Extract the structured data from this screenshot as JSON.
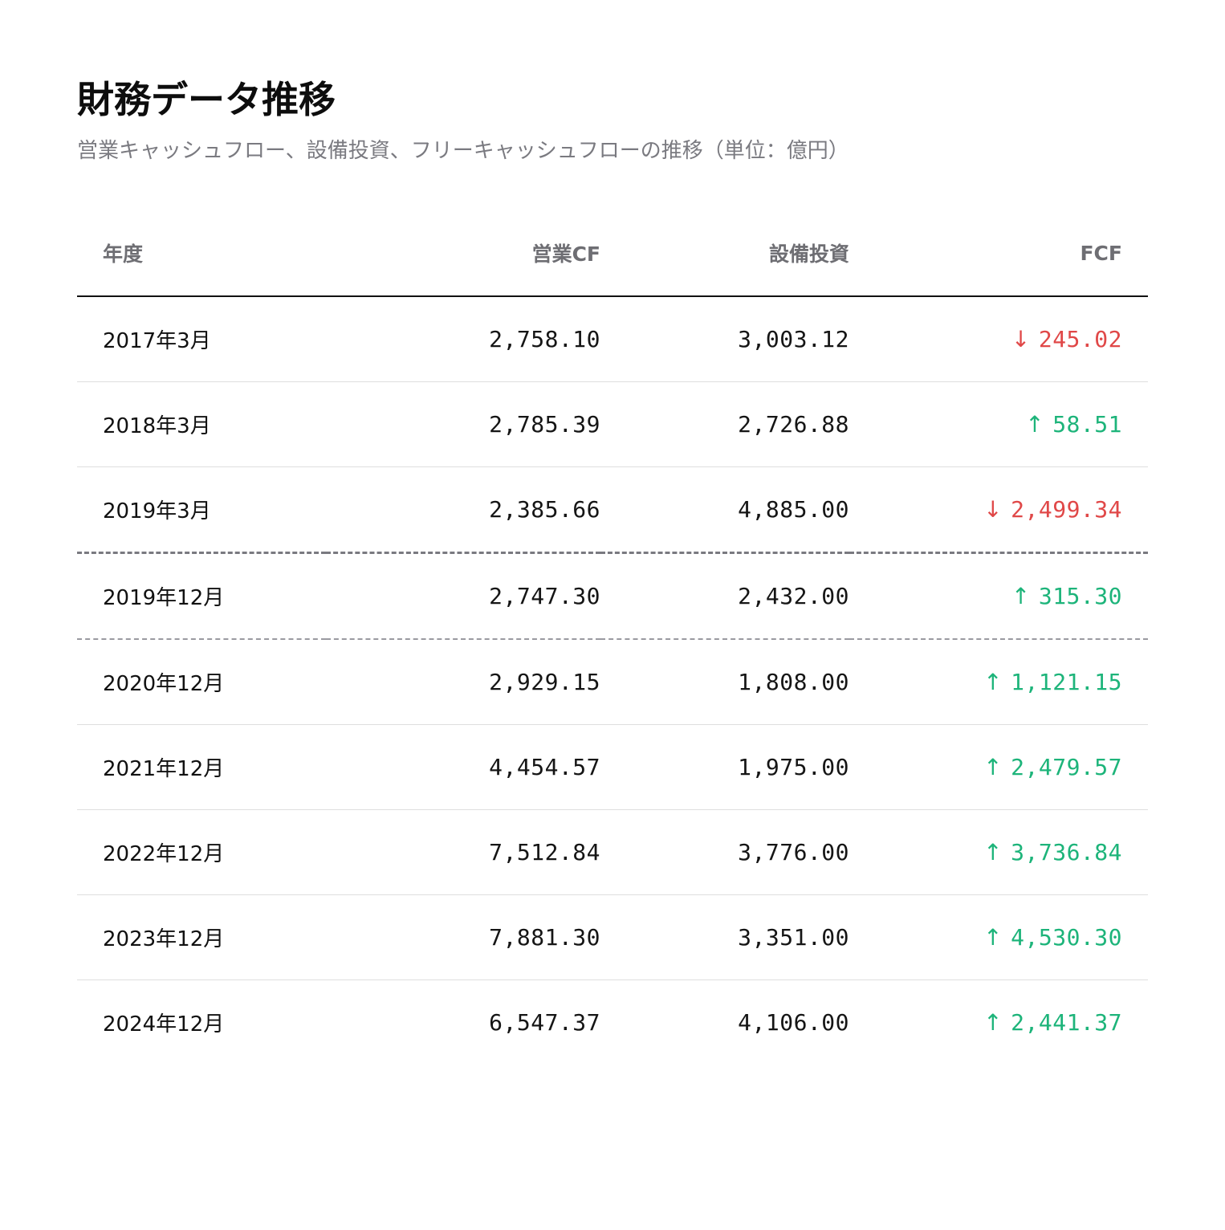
{
  "title": "財務データ推移",
  "subtitle": "営業キャッシュフロー、設備投資、フリーキャッシュフローの推移（単位：億円）",
  "table": {
    "headers": {
      "year": "年度",
      "operating_cf": "営業CF",
      "capex": "設備投資",
      "fcf": "FCF"
    },
    "rows": [
      {
        "year": "2017年3月",
        "operating_cf": "2,758.10",
        "capex": "3,003.12",
        "fcf": "245.02",
        "fcf_direction": "down"
      },
      {
        "year": "2018年3月",
        "operating_cf": "2,785.39",
        "capex": "2,726.88",
        "fcf": "58.51",
        "fcf_direction": "up"
      },
      {
        "year": "2019年3月",
        "operating_cf": "2,385.66",
        "capex": "4,885.00",
        "fcf": "2,499.34",
        "fcf_direction": "down"
      },
      {
        "year": "2019年12月",
        "operating_cf": "2,747.30",
        "capex": "2,432.00",
        "fcf": "315.30",
        "fcf_direction": "up"
      },
      {
        "year": "2020年12月",
        "operating_cf": "2,929.15",
        "capex": "1,808.00",
        "fcf": "1,121.15",
        "fcf_direction": "up"
      },
      {
        "year": "2021年12月",
        "operating_cf": "4,454.57",
        "capex": "1,975.00",
        "fcf": "2,479.57",
        "fcf_direction": "up"
      },
      {
        "year": "2022年12月",
        "operating_cf": "7,512.84",
        "capex": "3,776.00",
        "fcf": "3,736.84",
        "fcf_direction": "up"
      },
      {
        "year": "2023年12月",
        "operating_cf": "7,881.30",
        "capex": "3,351.00",
        "fcf": "4,530.30",
        "fcf_direction": "up"
      },
      {
        "year": "2024年12月",
        "operating_cf": "6,547.37",
        "capex": "4,106.00",
        "fcf": "2,441.37",
        "fcf_direction": "up"
      }
    ]
  },
  "icons": {
    "up": "arrow-up-icon",
    "down": "arrow-down-icon"
  },
  "colors": {
    "positive": "#1db47a",
    "negative": "#e04848",
    "text": "#111111",
    "muted": "#6e6e73"
  }
}
